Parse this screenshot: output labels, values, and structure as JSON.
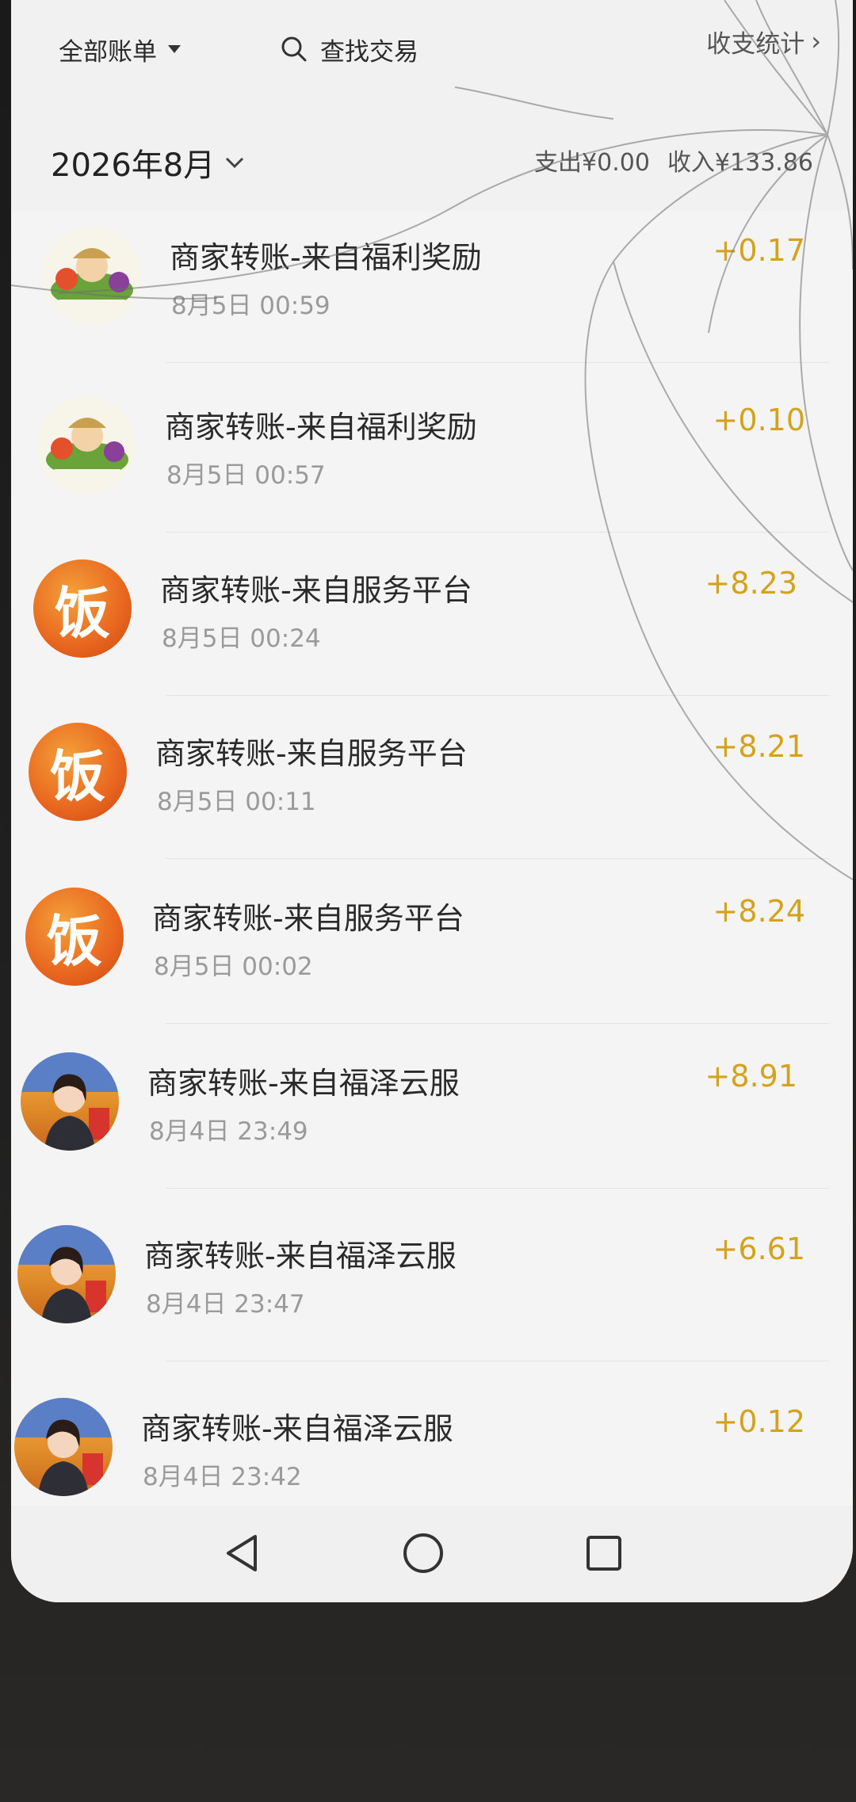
{
  "header": {
    "filter_label": "全部账单",
    "search_label": "查找交易",
    "stats_label": "收支统计",
    "month_label": "2026年8月",
    "expense_label": "支出¥0.00",
    "income_label": "收入¥133.86"
  },
  "transactions": [
    {
      "title": "商家转账-来自福利奖励",
      "time": "8月5日 00:59",
      "amount": "+0.17",
      "avatar": "farmer-avatar"
    },
    {
      "title": "商家转账-来自福利奖励",
      "time": "8月5日 00:57",
      "amount": "+0.10",
      "avatar": "farmer-avatar"
    },
    {
      "title": "商家转账-来自服务平台",
      "time": "8月5日 00:24",
      "amount": "+8.23",
      "avatar": "fan-avatar",
      "avatar_char": "饭"
    },
    {
      "title": "商家转账-来自服务平台",
      "time": "8月5日 00:11",
      "amount": "+8.21",
      "avatar": "fan-avatar",
      "avatar_char": "饭"
    },
    {
      "title": "商家转账-来自服务平台",
      "time": "8月5日 00:02",
      "amount": "+8.24",
      "avatar": "fan-avatar",
      "avatar_char": "饭"
    },
    {
      "title": "商家转账-来自福泽云服",
      "time": "8月4日 23:49",
      "amount": "+8.91",
      "avatar": "woman-avatar"
    },
    {
      "title": "商家转账-来自福泽云服",
      "time": "8月4日 23:47",
      "amount": "+6.61",
      "avatar": "woman-avatar"
    },
    {
      "title": "商家转账-来自福泽云服",
      "time": "8月4日 23:42",
      "amount": "+0.12",
      "avatar": "woman-avatar"
    }
  ],
  "navbar": {
    "back_icon": "back-triangle-icon",
    "home_icon": "home-circle-icon",
    "recents_icon": "recents-square-icon"
  },
  "colors": {
    "amount": "#d4a21c",
    "fan_avatar": "#e8661f",
    "background": "#f4f4f4"
  }
}
